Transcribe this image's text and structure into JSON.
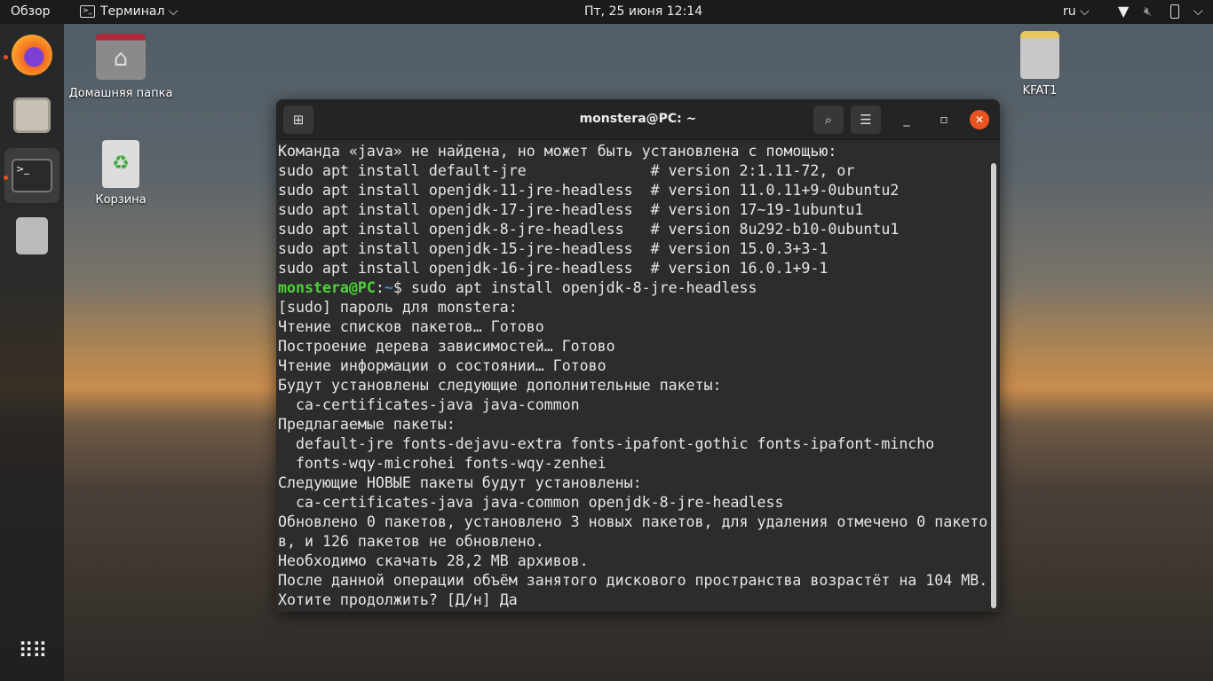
{
  "topbar": {
    "overview": "Обзор",
    "app_menu": "Терминал",
    "clock": "Пт, 25 июня  12:14",
    "lang": "ru"
  },
  "desktop": {
    "home": "Домашняя папка",
    "trash": "Корзина",
    "drive": "KFAT1"
  },
  "terminal": {
    "title": "monstera@PC: ~",
    "prompt_user": "monstera@PC",
    "prompt_sep": ":",
    "prompt_path": "~",
    "prompt_cmd": "$ sudo apt install openjdk-8-jre-headless",
    "lines_before": [
      "Команда «java» не найдена, но может быть установлена с помощью:",
      "sudo apt install default-jre              # version 2:1.11-72, or",
      "sudo apt install openjdk-11-jre-headless  # version 11.0.11+9-0ubuntu2",
      "sudo apt install openjdk-17-jre-headless  # version 17~19-1ubuntu1",
      "sudo apt install openjdk-8-jre-headless   # version 8u292-b10-0ubuntu1",
      "sudo apt install openjdk-15-jre-headless  # version 15.0.3+3-1",
      "sudo apt install openjdk-16-jre-headless  # version 16.0.1+9-1"
    ],
    "lines_after": [
      "[sudo] пароль для monstera:",
      "Чтение списков пакетов… Готово",
      "Построение дерева зависимостей… Готово",
      "Чтение информации о состоянии… Готово",
      "Будут установлены следующие дополнительные пакеты:",
      "  ca-certificates-java java-common",
      "Предлагаемые пакеты:",
      "  default-jre fonts-dejavu-extra fonts-ipafont-gothic fonts-ipafont-mincho",
      "  fonts-wqy-microhei fonts-wqy-zenhei",
      "Следующие НОВЫЕ пакеты будут установлены:",
      "  ca-certificates-java java-common openjdk-8-jre-headless",
      "Обновлено 0 пакетов, установлено 3 новых пакетов, для удаления отмечено 0 пакето",
      "в, и 126 пакетов не обновлено.",
      "Необходимо скачать 28,2 MB архивов.",
      "После данной операции объём занятого дискового пространства возрастёт на 104 MB.",
      "Хотите продолжить? [Д/н] Да"
    ]
  }
}
